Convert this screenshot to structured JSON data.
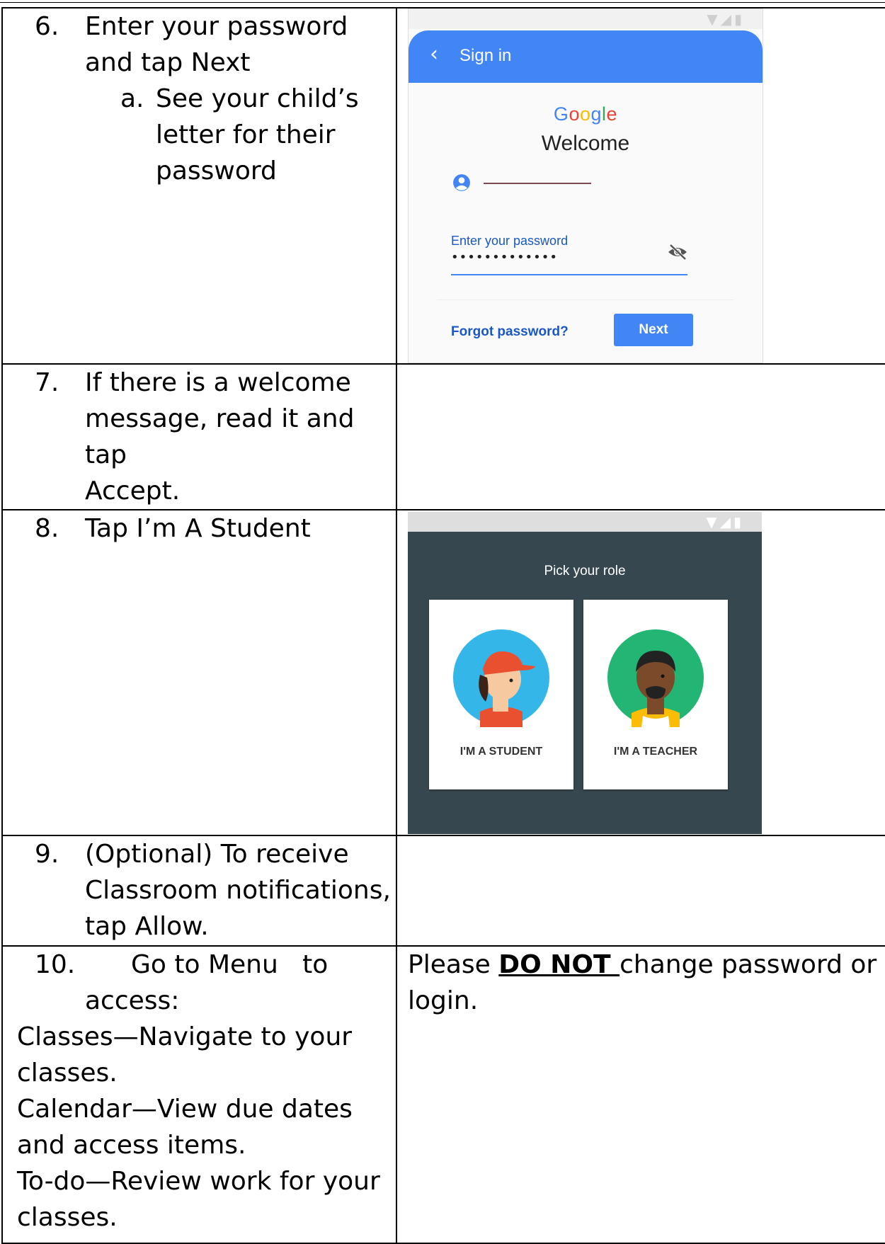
{
  "rows": [
    {
      "step_num": "6.",
      "step_lines": [
        "Enter your password",
        "and tap Next"
      ],
      "sub_num": "a.",
      "sub_lines": [
        "See your child’s",
        "letter for their",
        "password"
      ]
    },
    {
      "step_num": "7.",
      "step_lines": [
        "If there is a welcome",
        "message, read it and tap",
        "Accept."
      ]
    },
    {
      "step_num": "8.",
      "step_lines": [
        "Tap I’m A Student"
      ]
    },
    {
      "step_num": "9.",
      "step_lines": [
        "(Optional) To receive",
        "Classroom notifications,",
        "tap Allow."
      ]
    },
    {
      "step_num": "10.",
      "step_first_text": "Go to Menu   to",
      "step_lines": [
        "access:"
      ],
      "plain_lines": [
        "Classes—Navigate to your",
        "classes.",
        "Calendar—View due dates",
        "and access items.",
        "To-do—Review work for your",
        "classes."
      ],
      "note_before": "Please ",
      "note_bold": "DO NOT ",
      "note_after": "change password or",
      "note_line2": "login."
    }
  ],
  "signin_screen": {
    "title": "Sign in",
    "brand_letters": [
      "G",
      "o",
      "o",
      "g",
      "l",
      "e"
    ],
    "brand_colors": [
      "#4285f4",
      "#ea4335",
      "#fbbc05",
      "#4285f4",
      "#34a853",
      "#ea4335"
    ],
    "welcome": "Welcome",
    "password_label": "Enter your password",
    "password_dots": "•••••••••••••",
    "forgot": "Forgot password?",
    "next": "Next",
    "accent": "#4285f4",
    "icons": [
      "back-chevron-icon",
      "account-icon",
      "visibility-off-icon"
    ]
  },
  "role_screen": {
    "title": "Pick your role",
    "student_label": "I'M A STUDENT",
    "teacher_label": "I'M A TEACHER",
    "background": "#37474f"
  }
}
